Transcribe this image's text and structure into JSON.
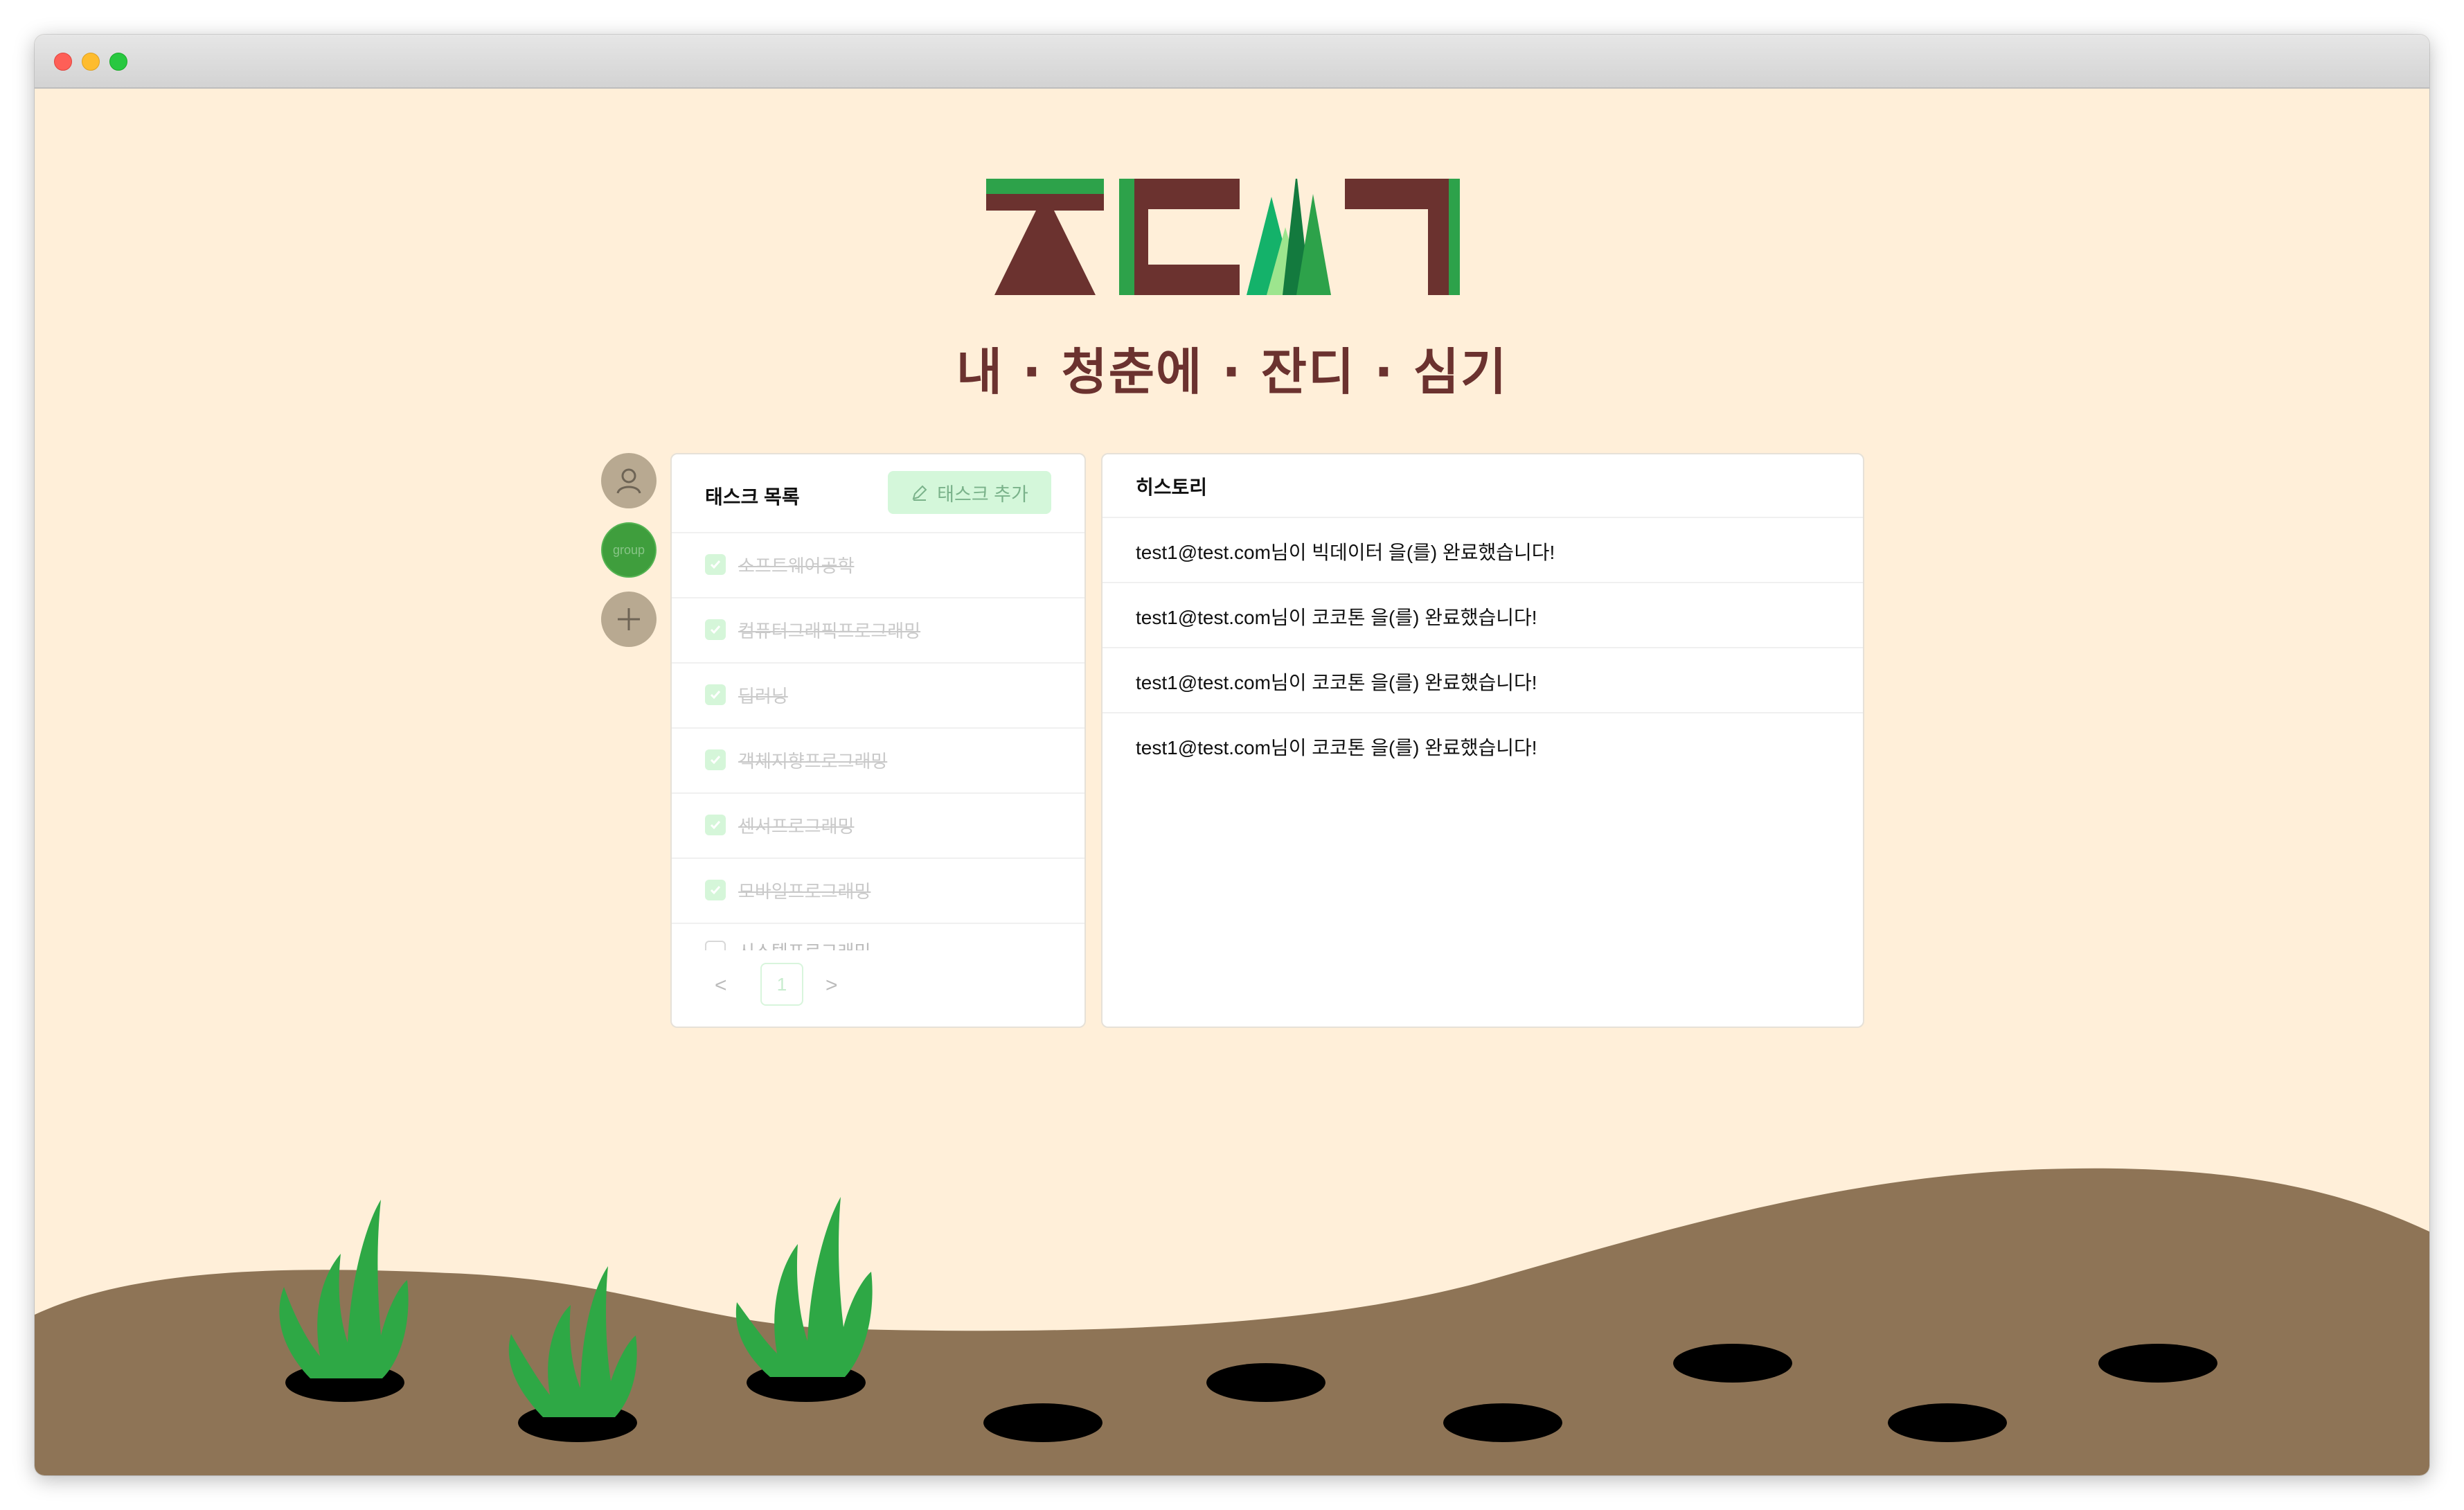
{
  "window": {
    "traffic_lights": [
      "close",
      "minimize",
      "zoom"
    ]
  },
  "logo": {
    "icon": "jandi-logo-icon",
    "colors": {
      "brown": "#6b322f",
      "green": "#2da24a",
      "light_green": "#9de58e",
      "dark_green": "#137a3e"
    }
  },
  "tagline": "내 · 청춘에 · 잔디 · 심기",
  "sidebar": {
    "profile_icon": "user-icon",
    "group_label": "group",
    "add_icon": "plus-icon"
  },
  "tasks": {
    "title": "태스크 목록",
    "add_button": "태스크 추가",
    "add_icon": "pencil-icon",
    "items": [
      {
        "label": "소프트웨어공학",
        "done": true
      },
      {
        "label": "컴퓨터그래픽프로그래밍",
        "done": true
      },
      {
        "label": "딥러닝",
        "done": true
      },
      {
        "label": "객체지향프로그래밍",
        "done": true
      },
      {
        "label": "센서프로그래밍",
        "done": true
      },
      {
        "label": "모바일프로그래밍",
        "done": true
      },
      {
        "label": "시스템프로그래밍",
        "done": false
      }
    ],
    "pagination": {
      "prev": "<",
      "page": "1",
      "next": ">"
    }
  },
  "history": {
    "title": "히스토리",
    "items": [
      "test1@test.com님이 빅데이터 을(를) 완료했습니다!",
      "test1@test.com님이 코코톤 을(를) 완료했습니다!",
      "test1@test.com님이 코코톤 을(를) 완료했습니다!",
      "test1@test.com님이 코코톤 을(를) 완료했습니다!"
    ]
  },
  "field": {
    "grass_count": 3,
    "empty_holes": 7,
    "colors": {
      "soil": "#8e7456",
      "hole": "#000000",
      "grass": "#2ea845",
      "sky": "#ffefd9"
    }
  }
}
